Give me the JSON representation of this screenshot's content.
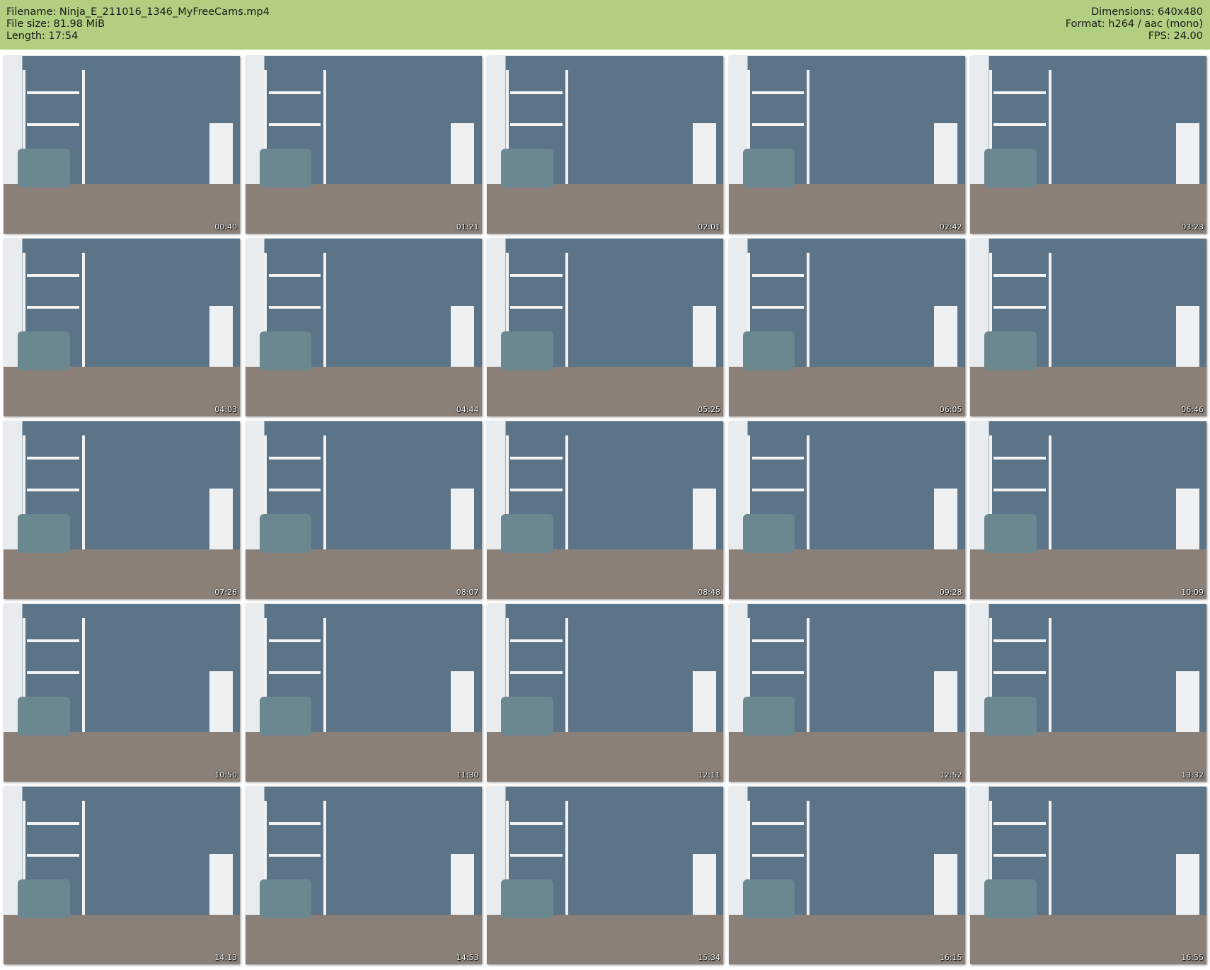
{
  "header": {
    "filename": "Filename: Ninja_E_211016_1346_MyFreeCams.mp4",
    "filesize": "File size: 81.98 MiB",
    "length": "Length: 17:54",
    "dimensions": "Dimensions: 640x480",
    "format": "Format: h264 / aac (mono)",
    "fps": "FPS: 24.00"
  },
  "colors": {
    "header_bg": "#b1ce81"
  },
  "thumbnails": [
    {
      "time": "00:40"
    },
    {
      "time": "01:21"
    },
    {
      "time": "02:01"
    },
    {
      "time": "02:42"
    },
    {
      "time": "03:23"
    },
    {
      "time": "04:03"
    },
    {
      "time": "04:44"
    },
    {
      "time": "05:25"
    },
    {
      "time": "06:05"
    },
    {
      "time": "06:46"
    },
    {
      "time": "07:26"
    },
    {
      "time": "08:07"
    },
    {
      "time": "08:48"
    },
    {
      "time": "09:28"
    },
    {
      "time": "10:09"
    },
    {
      "time": "10:50"
    },
    {
      "time": "11:30"
    },
    {
      "time": "12:11"
    },
    {
      "time": "12:52"
    },
    {
      "time": "13:32"
    },
    {
      "time": "14:13"
    },
    {
      "time": "14:53"
    },
    {
      "time": "15:34"
    },
    {
      "time": "16:15"
    },
    {
      "time": "16:55"
    }
  ]
}
